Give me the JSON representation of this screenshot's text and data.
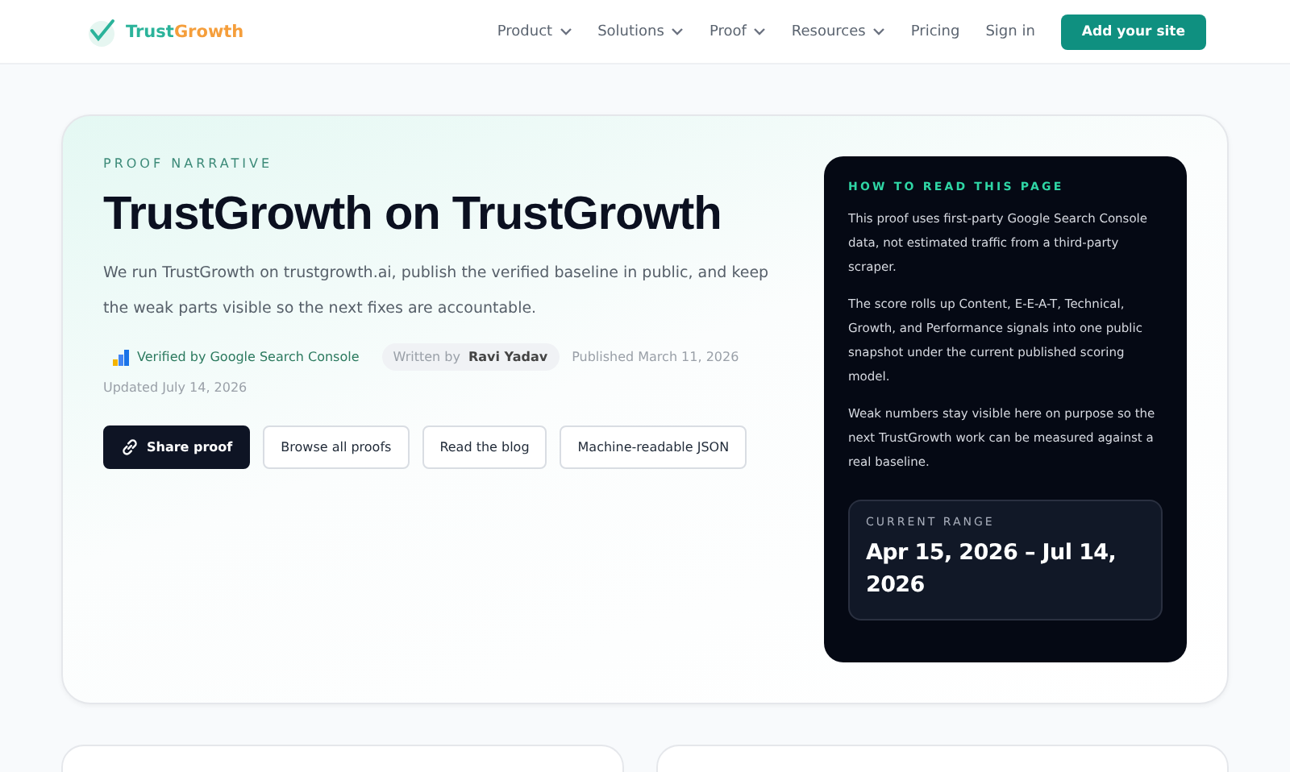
{
  "header": {
    "brand": {
      "first": "Trust",
      "second": "Growth"
    },
    "nav": [
      {
        "label": "Product",
        "has_menu": true
      },
      {
        "label": "Solutions",
        "has_menu": true
      },
      {
        "label": "Proof",
        "has_menu": true
      },
      {
        "label": "Resources",
        "has_menu": true
      },
      {
        "label": "Pricing",
        "has_menu": false
      },
      {
        "label": "Sign in",
        "has_menu": false
      }
    ],
    "cta": "Add your site"
  },
  "hero": {
    "eyebrow": "PROOF NARRATIVE",
    "title": "TrustGrowth on TrustGrowth",
    "lead": "We run TrustGrowth on trustgrowth.ai, publish the verified baseline in public, and keep the weak parts visible so the next fixes are accountable.",
    "verified": "Verified by Google Search Console",
    "written_by_label": "Written by",
    "author": "Ravi Yadav",
    "published": "Published March 11, 2026",
    "updated": "Updated July 14, 2026",
    "buttons": [
      {
        "label": "Share proof",
        "kind": "primary"
      },
      {
        "label": "Browse all proofs",
        "kind": "secondary"
      },
      {
        "label": "Read the blog",
        "kind": "secondary"
      },
      {
        "label": "Machine-readable JSON",
        "kind": "secondary"
      }
    ]
  },
  "guide": {
    "heading": "HOW TO READ THIS PAGE",
    "paragraphs": [
      "This proof uses first-party Google Search Console data, not estimated traffic from a third-party scraper.",
      "The score rolls up Content, E-E-A-T, Technical, Growth, and Performance signals into one public snapshot under the current published scoring model.",
      "Weak numbers stay visible here on purpose so the next TrustGrowth work can be measured against a real baseline."
    ],
    "range_label": "CURRENT RANGE",
    "range": "Apr 15, 2026 – Jul 14, 2026"
  }
}
